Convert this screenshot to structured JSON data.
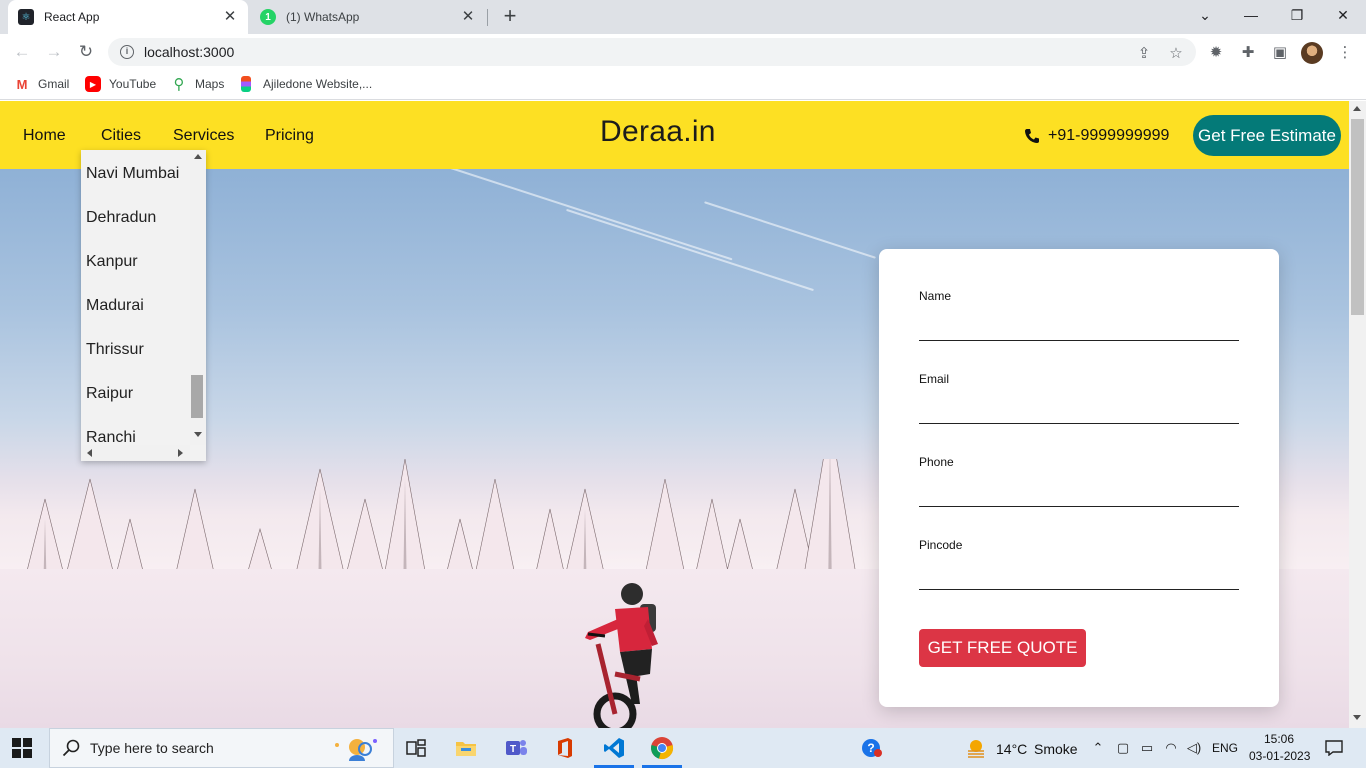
{
  "browser": {
    "tabs": [
      {
        "title": "React App",
        "active": true
      },
      {
        "title": "(1) WhatsApp",
        "active": false,
        "badge": "1"
      }
    ],
    "url": "localhost:3000",
    "bookmarks": [
      {
        "label": "Gmail",
        "icon": "gmail-icon"
      },
      {
        "label": "YouTube",
        "icon": "youtube-icon"
      },
      {
        "label": "Maps",
        "icon": "maps-icon"
      },
      {
        "label": "Ajiledone Website,...",
        "icon": "figma-icon"
      }
    ]
  },
  "site": {
    "nav": [
      "Home",
      "Cities",
      "Services",
      "Pricing"
    ],
    "brand": "Deraa.in",
    "phone": "+91-9999999999",
    "cta_label": "Get Free Estimate",
    "accent_yellow": "#fde023",
    "accent_teal": "#047a78",
    "accent_red": "#dc3545"
  },
  "cities_dropdown": {
    "items": [
      "Navi Mumbai",
      "Dehradun",
      "Kanpur",
      "Madurai",
      "Thrissur",
      "Raipur",
      "Ranchi"
    ]
  },
  "quote_form": {
    "fields": [
      {
        "label": "Name",
        "value": ""
      },
      {
        "label": "Email",
        "value": ""
      },
      {
        "label": "Phone",
        "value": ""
      },
      {
        "label": "Pincode",
        "value": ""
      }
    ],
    "submit_label": "GET FREE QUOTE"
  },
  "taskbar": {
    "search_placeholder": "Type here to search",
    "weather_temp": "14°C",
    "weather_desc": "Smoke",
    "language": "ENG",
    "time": "15:06",
    "date": "03-01-2023"
  }
}
